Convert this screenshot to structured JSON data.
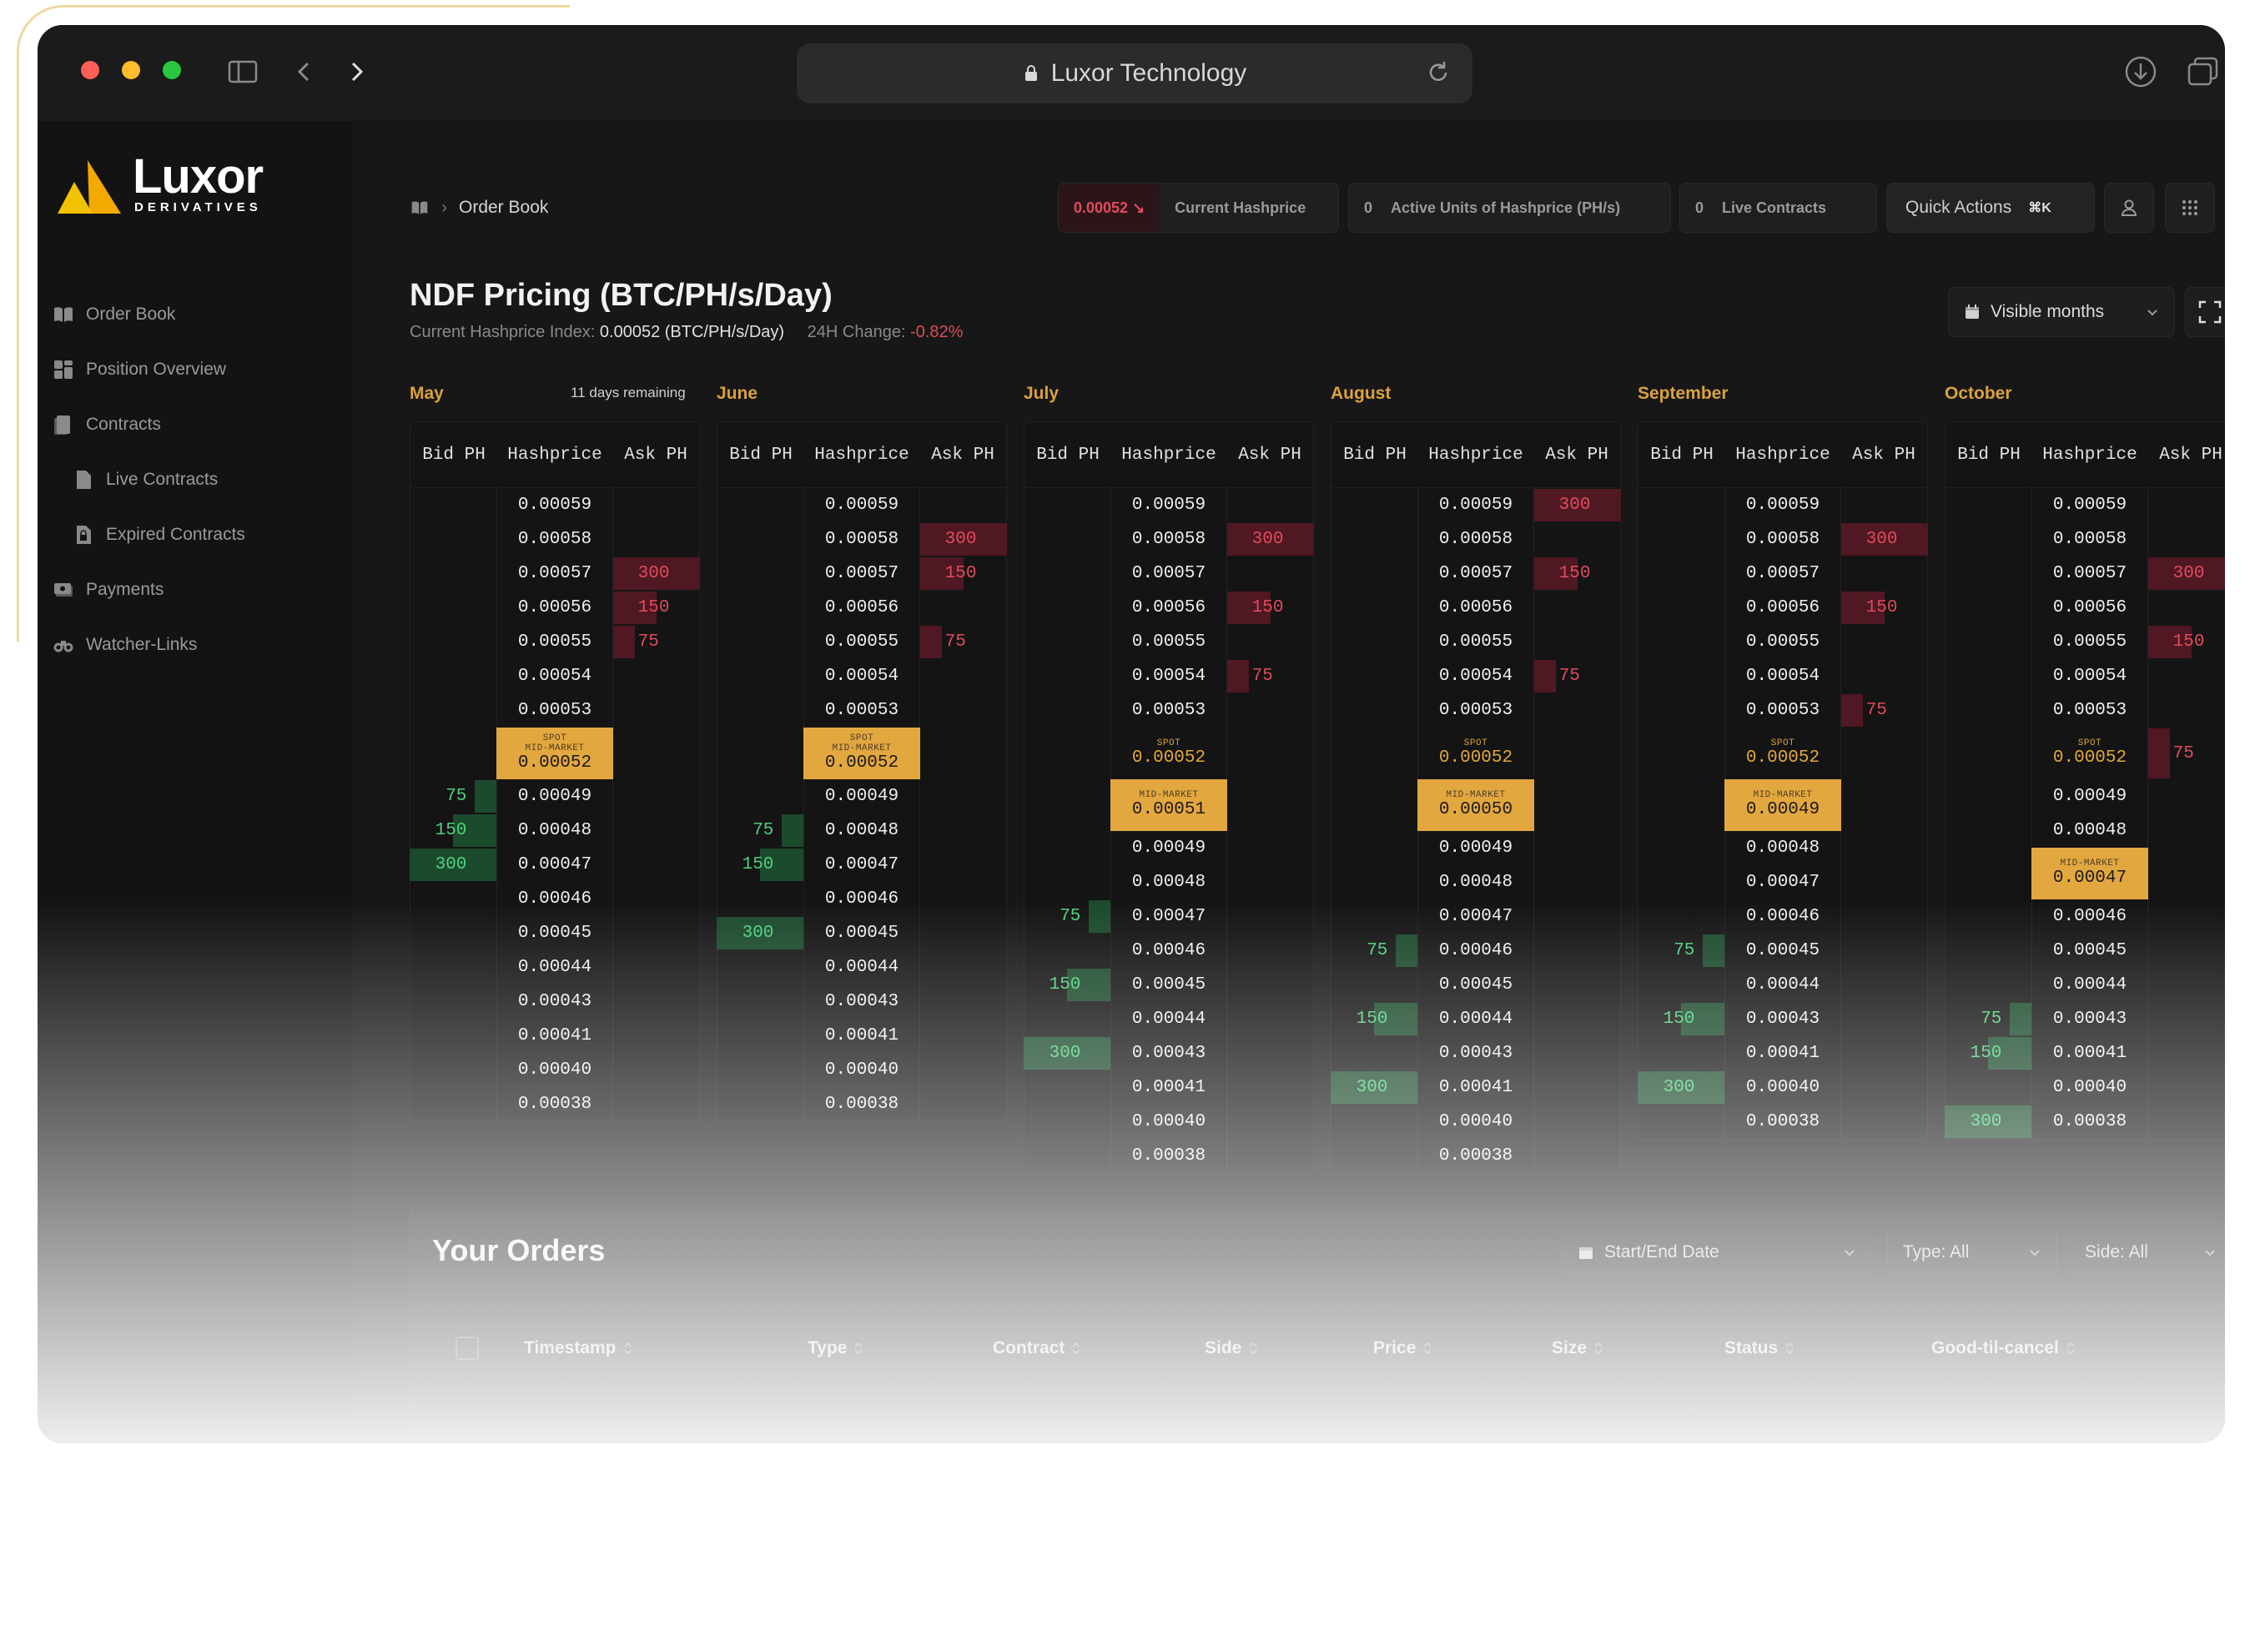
{
  "browser": {
    "url": "Luxor Technology"
  },
  "brand": {
    "name": "Luxor",
    "subtitle": "DERIVATIVES"
  },
  "sidebar": {
    "items": [
      {
        "label": "Order Book",
        "icon": "book-icon"
      },
      {
        "label": "Position Overview",
        "icon": "dashboard-icon"
      },
      {
        "label": "Contracts",
        "icon": "document-icon"
      },
      {
        "label": "Live Contracts",
        "icon": "document-icon"
      },
      {
        "label": "Expired Contracts",
        "icon": "document-lock-icon"
      },
      {
        "label": "Payments",
        "icon": "cash-icon"
      },
      {
        "label": "Watcher-Links",
        "icon": "binoculars-icon"
      }
    ]
  },
  "header": {
    "breadcrumb": "Order Book",
    "current_hashprice_value": "0.00052 ↘",
    "current_hashprice_label": "Current Hashprice",
    "active_units_value": "0",
    "active_units_label": "Active Units of Hashprice (PH/s)",
    "live_contracts_value": "0",
    "live_contracts_label": "Live Contracts",
    "quick_actions_label": "Quick Actions",
    "quick_actions_shortcut": "⌘K"
  },
  "page": {
    "title": "NDF Pricing (BTC/PH/s/Day)",
    "index_label": "Current Hashprice Index:",
    "index_value": "0.00052 (BTC/PH/s/Day)",
    "change_label": "24H Change:",
    "change_value": "-0.82%",
    "visible_months_label": "Visible months"
  },
  "book_headers": {
    "bid": "Bid PH",
    "hashprice": "Hashprice",
    "ask": "Ask PH"
  },
  "tags": {
    "spot": "SPOT",
    "mid": "MID-MARKET"
  },
  "months": [
    {
      "name": "May",
      "note": "11 days remaining",
      "rows": [
        {
          "hp": "0.00059"
        },
        {
          "hp": "0.00058"
        },
        {
          "hp": "0.00057",
          "ask": "300"
        },
        {
          "hp": "0.00056",
          "ask": "150"
        },
        {
          "hp": "0.00055",
          "ask": "75"
        },
        {
          "hp": "0.00054"
        },
        {
          "hp": "0.00053"
        },
        {
          "hp": "0.00052",
          "spot": true,
          "mid": true
        },
        {
          "hp": "0.00049",
          "bid": "75"
        },
        {
          "hp": "0.00048",
          "bid": "150"
        },
        {
          "hp": "0.00047",
          "bid": "300"
        },
        {
          "hp": "0.00046"
        },
        {
          "hp": "0.00045"
        },
        {
          "hp": "0.00044"
        },
        {
          "hp": "0.00043"
        },
        {
          "hp": "0.00041"
        },
        {
          "hp": "0.00040"
        },
        {
          "hp": "0.00038"
        }
      ]
    },
    {
      "name": "June",
      "note": "",
      "rows": [
        {
          "hp": "0.00059"
        },
        {
          "hp": "0.00058",
          "ask": "300"
        },
        {
          "hp": "0.00057",
          "ask": "150"
        },
        {
          "hp": "0.00056"
        },
        {
          "hp": "0.00055",
          "ask": "75"
        },
        {
          "hp": "0.00054"
        },
        {
          "hp": "0.00053"
        },
        {
          "hp": "0.00052",
          "spot": true,
          "mid": true
        },
        {
          "hp": "0.00049"
        },
        {
          "hp": "0.00048",
          "bid": "75"
        },
        {
          "hp": "0.00047",
          "bid": "150"
        },
        {
          "hp": "0.00046"
        },
        {
          "hp": "0.00045",
          "bid": "300"
        },
        {
          "hp": "0.00044"
        },
        {
          "hp": "0.00043"
        },
        {
          "hp": "0.00041"
        },
        {
          "hp": "0.00040"
        },
        {
          "hp": "0.00038"
        }
      ]
    },
    {
      "name": "July",
      "note": "",
      "rows": [
        {
          "hp": "0.00059"
        },
        {
          "hp": "0.00058",
          "ask": "300"
        },
        {
          "hp": "0.00057"
        },
        {
          "hp": "0.00056",
          "ask": "150"
        },
        {
          "hp": "0.00055"
        },
        {
          "hp": "0.00054",
          "ask": "75"
        },
        {
          "hp": "0.00053"
        },
        {
          "hp": "0.00052",
          "spot": true
        },
        {
          "hp": "0.00051",
          "mid": true
        },
        {
          "hp": "0.00049"
        },
        {
          "hp": "0.00048"
        },
        {
          "hp": "0.00047",
          "bid": "75"
        },
        {
          "hp": "0.00046"
        },
        {
          "hp": "0.00045",
          "bid": "150"
        },
        {
          "hp": "0.00044"
        },
        {
          "hp": "0.00043",
          "bid": "300"
        },
        {
          "hp": "0.00041"
        },
        {
          "hp": "0.00040"
        },
        {
          "hp": "0.00038"
        }
      ]
    },
    {
      "name": "August",
      "note": "",
      "rows": [
        {
          "hp": "0.00059",
          "ask": "300"
        },
        {
          "hp": "0.00058"
        },
        {
          "hp": "0.00057",
          "ask": "150"
        },
        {
          "hp": "0.00056"
        },
        {
          "hp": "0.00055"
        },
        {
          "hp": "0.00054",
          "ask": "75"
        },
        {
          "hp": "0.00053"
        },
        {
          "hp": "0.00052",
          "spot": true
        },
        {
          "hp": "0.00050",
          "mid": true
        },
        {
          "hp": "0.00049"
        },
        {
          "hp": "0.00048"
        },
        {
          "hp": "0.00047"
        },
        {
          "hp": "0.00046",
          "bid": "75"
        },
        {
          "hp": "0.00045"
        },
        {
          "hp": "0.00044",
          "bid": "150"
        },
        {
          "hp": "0.00043"
        },
        {
          "hp": "0.00041",
          "bid": "300"
        },
        {
          "hp": "0.00040"
        },
        {
          "hp": "0.00038"
        }
      ]
    },
    {
      "name": "September",
      "note": "",
      "rows": [
        {
          "hp": "0.00059"
        },
        {
          "hp": "0.00058",
          "ask": "300"
        },
        {
          "hp": "0.00057"
        },
        {
          "hp": "0.00056",
          "ask": "150"
        },
        {
          "hp": "0.00055"
        },
        {
          "hp": "0.00054"
        },
        {
          "hp": "0.00053",
          "ask": "75"
        },
        {
          "hp": "0.00052",
          "spot": true
        },
        {
          "hp": "0.00049",
          "mid": true
        },
        {
          "hp": "0.00048"
        },
        {
          "hp": "0.00047"
        },
        {
          "hp": "0.00046"
        },
        {
          "hp": "0.00045",
          "bid": "75"
        },
        {
          "hp": "0.00044"
        },
        {
          "hp": "0.00043",
          "bid": "150"
        },
        {
          "hp": "0.00041"
        },
        {
          "hp": "0.00040",
          "bid": "300"
        },
        {
          "hp": "0.00038"
        }
      ]
    },
    {
      "name": "October",
      "note": "",
      "rows": [
        {
          "hp": "0.00059"
        },
        {
          "hp": "0.00058"
        },
        {
          "hp": "0.00057",
          "ask": "300"
        },
        {
          "hp": "0.00056"
        },
        {
          "hp": "0.00055",
          "ask": "150"
        },
        {
          "hp": "0.00054"
        },
        {
          "hp": "0.00053"
        },
        {
          "hp": "0.00052",
          "spot": true,
          "ask": "75"
        },
        {
          "hp": "0.00049"
        },
        {
          "hp": "0.00048"
        },
        {
          "hp": "0.00047",
          "mid": true
        },
        {
          "hp": "0.00046"
        },
        {
          "hp": "0.00045"
        },
        {
          "hp": "0.00044"
        },
        {
          "hp": "0.00043",
          "bid": "75"
        },
        {
          "hp": "0.00041",
          "bid": "150"
        },
        {
          "hp": "0.00040"
        },
        {
          "hp": "0.00038",
          "bid": "300"
        }
      ]
    }
  ],
  "orders": {
    "title": "Your Orders",
    "filters": {
      "date": "Start/End Date",
      "type": "Type: All",
      "side": "Side: All"
    },
    "columns": [
      "Timestamp",
      "Type",
      "Contract",
      "Side",
      "Price",
      "Size",
      "Status",
      "Good-til-cancel"
    ]
  },
  "colors": {
    "accent": "#e3a740",
    "bid": "#4fd07e",
    "ask": "#e24b5d",
    "negative": "#d84f56"
  }
}
